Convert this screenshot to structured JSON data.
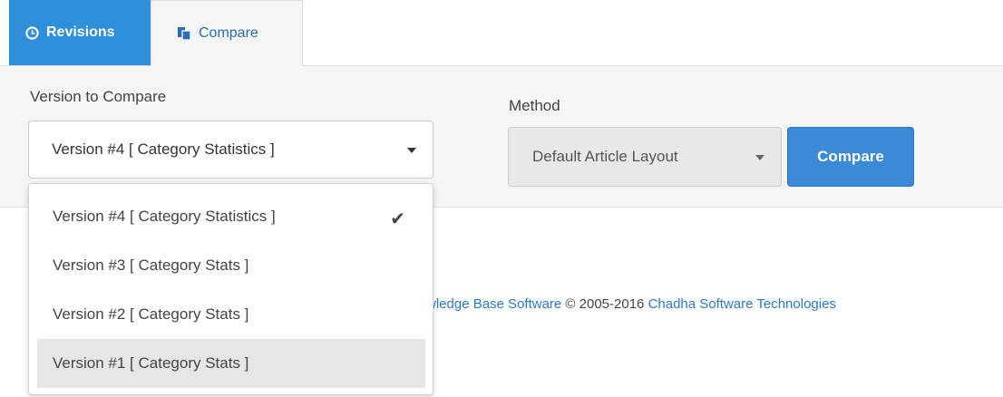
{
  "tabs": {
    "revisions_label": "Revisions",
    "compare_label": "Compare"
  },
  "form": {
    "version_label": "Version to Compare",
    "version_selected": "Version #4 [ Category Statistics ]",
    "method_label": "Method",
    "method_selected": "Default Article Layout",
    "compare_button": "Compare"
  },
  "dropdown": {
    "items": [
      {
        "label": "Version #4 [ Category Statistics ]",
        "selected": true
      },
      {
        "label": "Version #3 [ Category Stats ]",
        "selected": false
      },
      {
        "label": "Version #2 [ Category Stats ]",
        "selected": false
      },
      {
        "label": "Version #1 [ Category Stats ]",
        "selected": false,
        "highlighted": true
      }
    ],
    "check_icon": "checkmark-icon"
  },
  "footer": {
    "link1": "wledge Base Software",
    "copyright": " © 2005-2016 ",
    "link2": "Chadha Software Technologies"
  },
  "colors": {
    "accent": "#2f8fd8",
    "button": "#3a8ad6",
    "link": "#2a7ac8"
  },
  "icons": {
    "revisions": "clock-icon",
    "compare": "copy-icon"
  }
}
